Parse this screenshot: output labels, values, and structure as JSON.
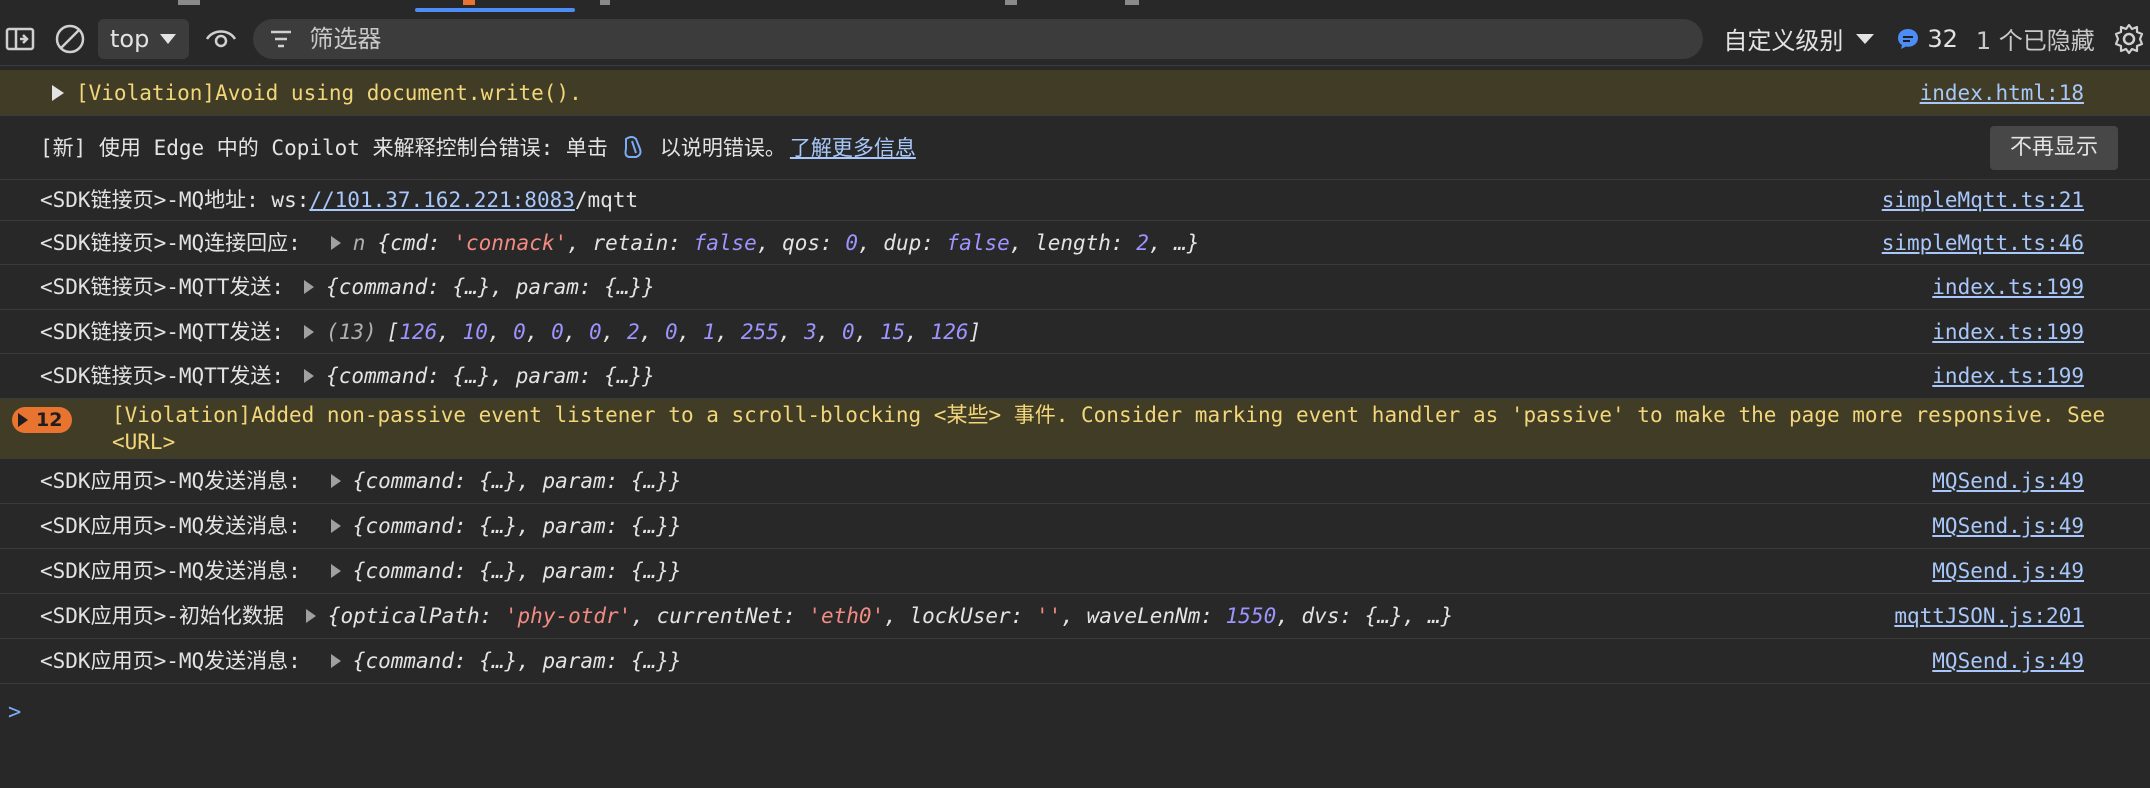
{
  "toolbar": {
    "context": "top",
    "filter_placeholder": "筛选器",
    "levels_label": "自定义级别",
    "issues_count": "32",
    "hidden_label": "1 个已隐藏"
  },
  "colors": {
    "accent": "#4c8df6",
    "warning_bg": "#413c26",
    "badge": "#e8742f",
    "link": "#a8c7fa"
  },
  "rows": {
    "r0": {
      "text": "[Violation]Avoid using document.write().",
      "source": "index.html:18"
    },
    "r1": {
      "before": "[新] 使用 Edge 中的 Copilot 来解释控制台错误: 单击",
      "after": "以说明错误。",
      "link": "了解更多信息",
      "button": "不再显示"
    },
    "r2": {
      "prefix": "<SDK链接页>-MQ地址: ws:",
      "url": "//101.37.162.221:8083",
      "suffix": "/mqtt",
      "source": "simpleMqtt.ts:21"
    },
    "r3": {
      "prefix": "<SDK链接页>-MQ连接回应:",
      "class_name": "n",
      "source": "simpleMqtt.ts:46"
    },
    "r4": {
      "prefix": "<SDK链接页>-MQTT发送:",
      "obj": "{command: {…}, param: {…}}",
      "source": "index.ts:199"
    },
    "r5": {
      "prefix": "<SDK链接页>-MQTT发送:",
      "len": "(13)",
      "source": "index.ts:199"
    },
    "r6": {
      "prefix": "<SDK链接页>-MQTT发送:",
      "obj": "{command: {…}, param: {…}}",
      "source": "index.ts:199"
    },
    "r7": {
      "count": "12",
      "line1": "[Violation]Added non-passive event listener to a scroll-blocking <某些> 事件. Consider marking event handler as 'passive' to make the page more responsive. See",
      "line2": "<URL>"
    },
    "r8": {
      "prefix": "<SDK应用页>-MQ发送消息:",
      "obj": "{command: {…}, param: {…}}",
      "source": "MQSend.js:49"
    },
    "r9": {
      "prefix": "<SDK应用页>-MQ发送消息:",
      "obj": "{command: {…}, param: {…}}",
      "source": "MQSend.js:49"
    },
    "r10": {
      "prefix": "<SDK应用页>-MQ发送消息:",
      "obj": "{command: {…}, param: {…}}",
      "source": "MQSend.js:49"
    },
    "r11": {
      "prefix": "<SDK应用页>-初始化数据",
      "source": "mqttJSON.js:201"
    },
    "r12": {
      "prefix": "<SDK应用页>-MQ发送消息:",
      "obj": "{command: {…}, param: {…}}",
      "source": "MQSend.js:49"
    }
  },
  "r3_obj": {
    "cmd_key": "cmd",
    "cmd_val": "'connack'",
    "retain_key": "retain",
    "retain_val": "false",
    "qos_key": "qos",
    "qos_val": "0",
    "dup_key": "dup",
    "dup_val": "false",
    "length_key": "length",
    "length_val": "2"
  },
  "r5_vals": [
    "126",
    "10",
    "0",
    "0",
    "0",
    "2",
    "0",
    "1",
    "255",
    "3",
    "0",
    "15",
    "126"
  ],
  "r11_obj": {
    "k1": "opticalPath",
    "v1": "'phy-otdr'",
    "k2": "currentNet",
    "v2": "'eth0'",
    "k3": "lockUser",
    "v3": "''",
    "k4": "waveLenNm",
    "v4": "1550",
    "k5": "dvs",
    "v5": "{…}"
  }
}
